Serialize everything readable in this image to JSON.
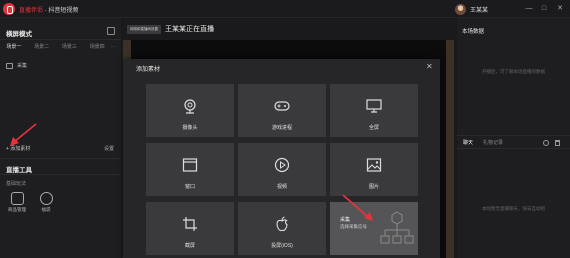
{
  "titlebar": {
    "app_name": "直播伴侣",
    "app_subtitle": "抖音短视频",
    "username": "王某某",
    "controls": [
      "—",
      "□",
      "✕"
    ]
  },
  "left": {
    "layout_title": "横屏模式",
    "scene_tabs": [
      "场景一",
      "场景二",
      "场景三",
      "场景四"
    ],
    "scene_more": "···",
    "sources": [
      {
        "label": "采集"
      }
    ],
    "add_source": "+ 添加素材",
    "settings": "设置",
    "tools_title": "直播工具",
    "tools_subtitle": "基础玩法",
    "tools": [
      {
        "label": "商品管理",
        "icon": "bag-icon"
      },
      {
        "label": "福袋",
        "icon": "gift-icon"
      }
    ]
  },
  "middle": {
    "room_badge": "网络和直播间设置",
    "room_title": "王某某正在直播",
    "edit_icon": "✎"
  },
  "right": {
    "title": "本场数据",
    "empty_hint": "开播后，可了解本场直播的数据",
    "tabs": [
      "聊天",
      "礼物记录"
    ],
    "chat_empty": "本场暂无直播聊天，快去互动吧"
  },
  "modal": {
    "title": "添加素材",
    "close": "✕",
    "tiles": [
      {
        "label": "摄像头",
        "icon": "webcam-icon"
      },
      {
        "label": "游戏进程",
        "icon": "gamepad-icon"
      },
      {
        "label": "全屏",
        "icon": "monitor-icon"
      },
      {
        "label": "窗口",
        "icon": "window-icon"
      },
      {
        "label": "视频",
        "icon": "play-icon"
      },
      {
        "label": "图片",
        "icon": "image-icon"
      },
      {
        "label": "截屏",
        "icon": "crop-icon"
      },
      {
        "label": "投屏(iOS)",
        "icon": "apple-icon"
      },
      {
        "label": "采集",
        "sublabel": "选择采集信号",
        "icon": "capture-icon",
        "highlight": true
      }
    ]
  },
  "colors": {
    "accent": "#e5333d",
    "bg": "#19191b",
    "tile": "#3a3a3c",
    "stage_brown": "#3b3126"
  }
}
